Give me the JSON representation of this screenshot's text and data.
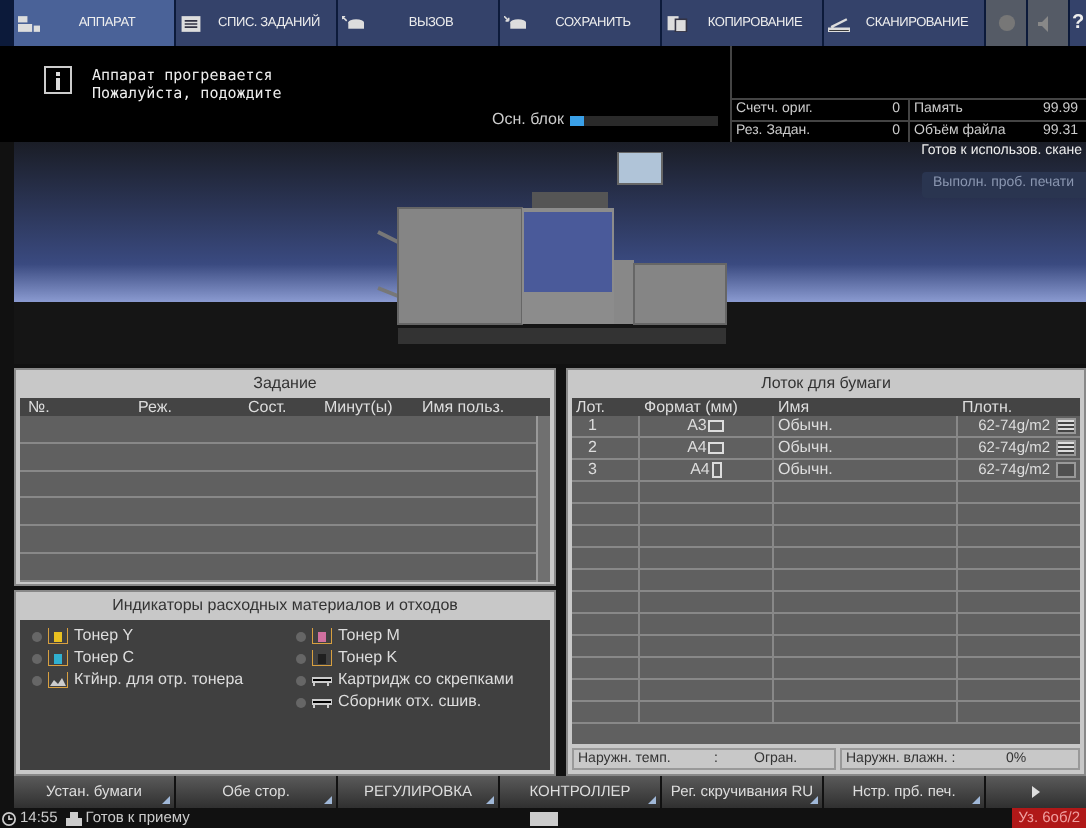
{
  "tabs": [
    {
      "label": "АППАРАТ",
      "selected": true
    },
    {
      "label": "СПИС. ЗАДАНИЙ",
      "selected": false
    },
    {
      "label": "ВЫЗОВ",
      "selected": false
    },
    {
      "label": "СОХРАНИТЬ",
      "selected": false
    },
    {
      "label": "КОПИРОВАНИЕ",
      "selected": false
    },
    {
      "label": "СКАНИРОВАНИЕ",
      "selected": false
    }
  ],
  "help_label": "?",
  "message": {
    "lines": [
      "Аппарат прогревается",
      "Пожалуйста, подождите"
    ]
  },
  "main_unit": {
    "label": "Осн. блок",
    "level": 0.1
  },
  "counters": [
    {
      "label": "Счетч. ориг.",
      "value": "0"
    },
    {
      "label": "Память",
      "value": "99.99"
    },
    {
      "label": "Рез. Задан.",
      "value": "0"
    },
    {
      "label": "Объём файла",
      "value": "99.31"
    }
  ],
  "status_text": "Готов к использов. скане",
  "proof_button": "Выполн. проб. печати",
  "jobs": {
    "title": "Задание",
    "columns": [
      "№.",
      "Реж.",
      "Сост.",
      "Минут(ы)",
      "Имя польз."
    ]
  },
  "consumables": {
    "title": "Индикаторы расходных материалов и отходов",
    "columns": [
      [
        {
          "kind": "toner",
          "label": "Тонер Y",
          "color": "#e8c020"
        },
        {
          "kind": "toner",
          "label": "Тонер C",
          "color": "#30b0d0"
        },
        {
          "kind": "waste",
          "label": "Ктйнр. для отр. тонера"
        }
      ],
      [
        {
          "kind": "toner",
          "label": "Тонер M",
          "color": "#d070a0"
        },
        {
          "kind": "toner",
          "label": "Тонер K",
          "color": "#202020"
        },
        {
          "kind": "staple",
          "label": "Картридж со скрепками"
        },
        {
          "kind": "staple",
          "label": "Сборник отх. сшив."
        }
      ]
    ]
  },
  "paper_tray": {
    "title": "Лоток для бумаги",
    "columns": [
      "Лот.",
      "Формат (мм)",
      "Имя",
      "Плотн."
    ],
    "rows": [
      {
        "tray": "1",
        "format": "A3",
        "kind": "landscape",
        "name": "Обычн.",
        "weight": "62-74g/m2",
        "level": 1
      },
      {
        "tray": "2",
        "format": "A4",
        "kind": "landscape",
        "name": "Обычн.",
        "weight": "62-74g/m2",
        "level": 1
      },
      {
        "tray": "3",
        "format": "A4",
        "kind": "portrait",
        "name": "Обычн.",
        "weight": "62-74g/m2",
        "level": 0
      }
    ],
    "footer": [
      {
        "label": "Наружн. темп.",
        "sep": ":",
        "value": "Огран."
      },
      {
        "label": "Наружн. влажн. :",
        "value": "0%"
      }
    ]
  },
  "bottom_buttons": [
    "Устан. бумаги",
    "Обе стор.",
    "РЕГУЛИРОВКА",
    "КОНТРОЛЛЕР",
    "Рег. скручивания RU",
    "Нстр. прб. печ."
  ],
  "status_bar": {
    "time": "14:55",
    "state": "Готов к приему",
    "alert": "Уз. 6об/2"
  }
}
